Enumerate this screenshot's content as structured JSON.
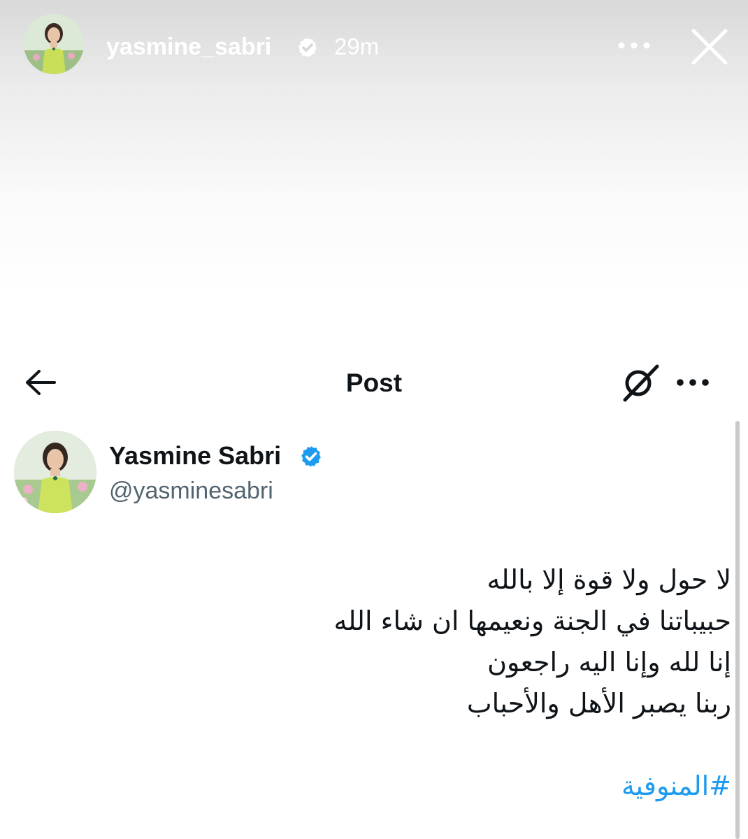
{
  "story": {
    "username": "yasmine_sabri",
    "time": "29m",
    "verified_icon": "verified-badge-icon",
    "more_icon": "more-horizontal-icon",
    "close_icon": "close-icon"
  },
  "post_header": {
    "title": "Post",
    "back_icon": "back-arrow-icon",
    "grok_icon": "grok-icon",
    "more_icon": "more-horizontal-icon"
  },
  "author": {
    "name": "Yasmine Sabri",
    "handle": "@yasminesabri",
    "verified_icon": "verified-badge-icon"
  },
  "tweet": {
    "lines": [
      "لا حول ولا قوة إلا بالله",
      "حبيباتنا في الجنة ونعيمها ان شاء الله",
      "إنا لله وإنا اليه راجعون",
      "ربنا يصبر الأهل والأحباب"
    ],
    "hashtag": "#المنوفية"
  },
  "colors": {
    "link": "#1d9bf0",
    "verified": "#1d9bf0",
    "text": "#0f1419",
    "secondary_text": "#536471"
  }
}
